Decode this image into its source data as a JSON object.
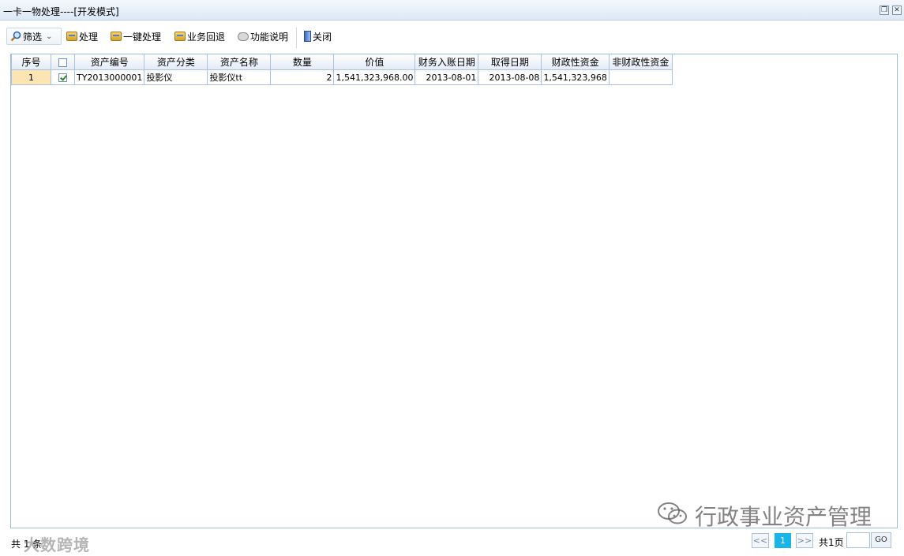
{
  "window": {
    "title": "一卡一物处理----[开发模式]"
  },
  "toolbar": {
    "filter_label": "筛选",
    "process_label": "处理",
    "oneclick_label": "一键处理",
    "rollback_label": "业务回退",
    "help_label": "功能说明",
    "close_label": "关闭"
  },
  "table": {
    "headers": [
      "序号",
      "资产编号",
      "资产分类",
      "资产名称",
      "数量",
      "价值",
      "财务入账日期",
      "取得日期",
      "财政性资金",
      "非财政性资金"
    ],
    "rows": [
      {
        "seq": "1",
        "checked": true,
        "asset_no": "TY2013000001",
        "category": "投影仪",
        "name": "投影仪tt",
        "qty": "2",
        "value": "1,541,323,968.00",
        "entry_date": "2013-08-01",
        "acquire_date": "2013-08-08",
        "fiscal": "1,541,323,968",
        "nonfiscal": ""
      }
    ]
  },
  "status": {
    "total": "共 1 条"
  },
  "pager": {
    "prev": "<<",
    "current": "1",
    "next": ">>",
    "total_pages": "共1页",
    "go_label": "GO",
    "page_input": ""
  },
  "watermark": {
    "left": "大数跨境",
    "right": "行政事业资产管理"
  }
}
